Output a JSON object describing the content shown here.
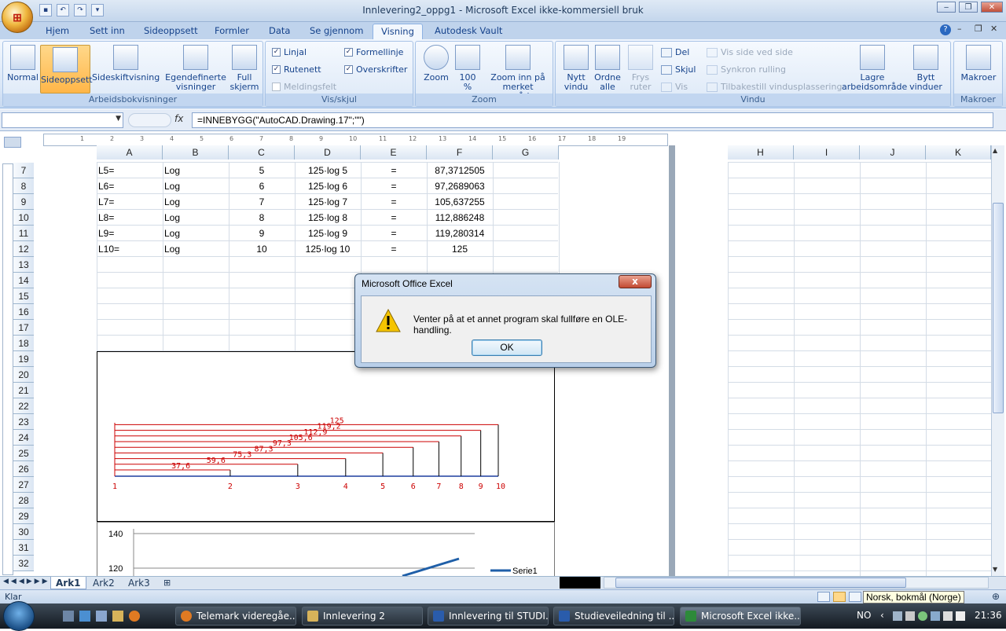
{
  "window": {
    "title": "Innlevering2_oppg1 - Microsoft Excel ikke-kommersiell bruk"
  },
  "ribbon_tabs": [
    "Hjem",
    "Sett inn",
    "Sideoppsett",
    "Formler",
    "Data",
    "Se gjennom",
    "Visning",
    "Autodesk Vault"
  ],
  "active_tab": "Visning",
  "groups": {
    "workbook_views": {
      "label": "Arbeidsbokvisninger",
      "normal": "Normal",
      "page_layout": "Sideoppsett",
      "page_break": "Sideskiftvisning",
      "custom_views": "Egendefinerte visninger",
      "full_screen": "Full skjerm"
    },
    "show_hide": {
      "label": "Vis/skjul",
      "ruler": "Linjal",
      "formula_bar": "Formellinje",
      "gridlines": "Rutenett",
      "headings": "Overskrifter",
      "message_bar": "Meldingsfelt"
    },
    "zoom": {
      "label": "Zoom",
      "zoom": "Zoom",
      "zoom100": "100 %",
      "zoom_selection": "Zoom inn på merket område"
    },
    "window": {
      "label": "Vindu",
      "new_window": "Nytt vindu",
      "arrange_all": "Ordne alle",
      "freeze_panes": "Frys ruter",
      "split": "Del",
      "hide": "Skjul",
      "unhide": "Vis",
      "side_by_side": "Vis side ved side",
      "sync_scroll": "Synkron rulling",
      "reset_position": "Tilbakestill vindusplassering",
      "save_workspace": "Lagre arbeidsområde",
      "switch_windows": "Bytt vinduer"
    },
    "macros": {
      "label": "Makroer",
      "macros": "Makroer"
    }
  },
  "formula_bar": {
    "fx": "fx",
    "formula": "=INNEBYGG(\"AutoCAD.Drawing.17\";\"\")"
  },
  "columns_left": [
    "A",
    "B",
    "C",
    "D",
    "E",
    "F",
    "G"
  ],
  "columns_right": [
    "H",
    "I",
    "J",
    "K"
  ],
  "row_numbers": [
    "7",
    "8",
    "9",
    "10",
    "11",
    "12",
    "13",
    "14",
    "15",
    "16",
    "17",
    "18",
    "19",
    "20",
    "21",
    "22",
    "23",
    "24",
    "25",
    "26",
    "27",
    "28",
    "29",
    "30",
    "31",
    "32"
  ],
  "rows": [
    [
      "L5=",
      "Log",
      "5",
      "125·log 5",
      "=",
      "87,3712505"
    ],
    [
      "L6=",
      "Log",
      "6",
      "125·log 6",
      "=",
      "97,2689063"
    ],
    [
      "L7=",
      "Log",
      "7",
      "125·log 7",
      "=",
      "105,637255"
    ],
    [
      "L8=",
      "Log",
      "8",
      "125·log 8",
      "=",
      "112,886248"
    ],
    [
      "L9=",
      "Log",
      "9",
      "125·log 9",
      "=",
      "119,280314"
    ],
    [
      "L10=",
      "Log",
      "10",
      "125·log 10",
      "=",
      "125"
    ]
  ],
  "cad_drawing": {
    "x_labels": [
      "1",
      "2",
      "3",
      "4",
      "5",
      "6",
      "7",
      "8",
      "9",
      "10"
    ],
    "value_labels": [
      "37,6",
      "59,6",
      "75,3",
      "87,3",
      "97,3",
      "105,6",
      "112,9",
      "119,2",
      "125"
    ]
  },
  "chart_data": {
    "type": "line",
    "title": "",
    "y_ticks": [
      "140",
      "120"
    ],
    "series": [
      {
        "name": "Serie1"
      }
    ]
  },
  "sheets": [
    "Ark1",
    "Ark2",
    "Ark3"
  ],
  "active_sheet": "Ark1",
  "status": {
    "ready": "Klar",
    "language_tooltip": "Norsk, bokmål (Norge)"
  },
  "taskbar": {
    "items": [
      "Telemark videregåe...",
      "Innlevering 2",
      "Innlevering til STUDI...",
      "Studieveiledning til ...",
      "Microsoft Excel ikke..."
    ],
    "tray_lang": "NO",
    "clock": "21:36"
  },
  "dialog": {
    "title": "Microsoft Office Excel",
    "message": "Venter på at et annet program skal fullføre en OLE-handling.",
    "ok": "OK",
    "close": "x"
  },
  "colors": {
    "ribbon": "#dbe7f6",
    "cad_red": "#cc0000",
    "series_blue": "#1f5fa8"
  }
}
